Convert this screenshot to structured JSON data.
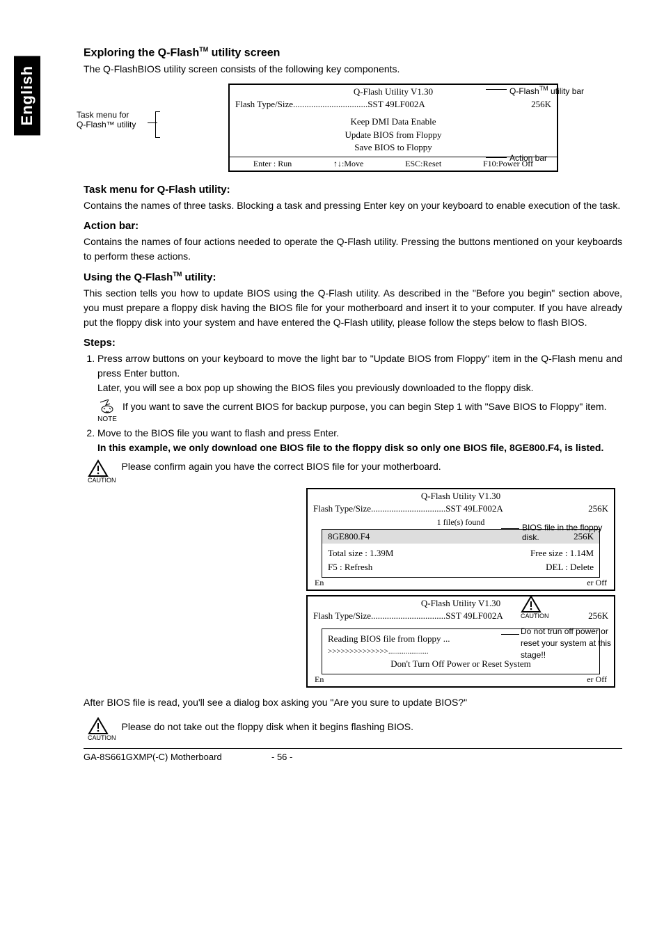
{
  "lang_tab": "English",
  "sec1_title_a": "Exploring the Q-Flash",
  "sec1_title_tm": "TM",
  "sec1_title_b": " utility screen",
  "sec1_intro": "The Q-FlashBIOS utility screen consists of the following key components.",
  "diagram1": {
    "left_label_l1": "Task menu for",
    "left_label_l2": "Q-Flash™ utility",
    "right_label_top_a": "Q-Flash",
    "right_label_top_tm": "TM",
    "right_label_top_b": " utility bar",
    "right_label_bot": "Action bar",
    "title": "Q-Flash Utility V1.30",
    "flash_label": "Flash Type/Size.................................SST 49LF002A",
    "flash_size": "256K",
    "menu_l1": "Keep DMI Data    Enable",
    "menu_l2": "Update BIOS from Floppy",
    "menu_l3": "Save BIOS to Floppy",
    "act1": "Enter : Run",
    "act2": "↑↓:Move",
    "act3": "ESC:Reset",
    "act4": "F10:Power Off"
  },
  "task_menu_heading": "Task menu for Q-Flash utility:",
  "task_menu_body": "Contains the names of three tasks. Blocking a task and pressing Enter key on your keyboard to enable execution of the task.",
  "action_bar_heading": "Action bar:",
  "action_bar_body": "Contains the names of four actions needed to operate the Q-Flash utility. Pressing the buttons mentioned on your keyboards to perform these actions.",
  "using_title_a": "Using the Q-Flash",
  "using_title_tm": "TM",
  "using_title_b": " utility:",
  "using_body": "This section tells you how to update BIOS using the Q-Flash utility. As described in the \"Before you begin\" section above, you must prepare a floppy disk having the BIOS file for your motherboard and insert it to your computer. If you have already put the floppy disk into your system and have entered the Q-Flash utility, please follow the steps below to flash BIOS.",
  "steps_heading": "Steps:",
  "step1_a": "Press arrow buttons on your keyboard to move the light bar to \"Update BIOS from Floppy\" item in the  Q-Flash menu and press Enter button.",
  "step1_b": "Later, you will see a box pop up showing the BIOS files you previously downloaded to the floppy disk.",
  "note1": "If you want to save the current BIOS for backup purpose, you can begin Step 1 with \"Save BIOS to Floppy\" item.",
  "note_label": "NOTE",
  "step2_a": "Move to the BIOS file you want to flash and press Enter.",
  "step2_bold": "In this example, we only download one BIOS file to the floppy disk so only one BIOS file, 8GE800.F4, is listed.",
  "caution1": "Please confirm again you have the correct BIOS file for your motherboard.",
  "caution_label": "CAUTION",
  "diagram2": {
    "title": "Q-Flash Utility V1.30",
    "flash_label": "Flash Type/Size.................................SST 49LF002A",
    "flash_size": "256K",
    "files_found": "1 file(s) found",
    "file_name": "8GE800.F4",
    "file_size": "256K",
    "total": "Total size : 1.39M",
    "free": "Free size : 1.14M",
    "refresh": "F5 : Refresh",
    "delete": "DEL : Delete",
    "left_trunc": "En",
    "right_trunc": "er Off",
    "right_label_l1": "BIOS file in the floppy",
    "right_label_l2": "disk."
  },
  "diagram3": {
    "title": "Q-Flash Utility V1.30",
    "flash_label": "Flash Type/Size.................................SST 49LF002A",
    "flash_size": "256K",
    "reading": "Reading BIOS file from floppy ...",
    "progress": ">>>>>>>>>>>>>>.....................",
    "warn": "Don't Turn Off Power or Reset System",
    "left_trunc": "En",
    "right_trunc": "er Off",
    "right_label_l1": "Do not trun off power or",
    "right_label_l2": "reset your system at this",
    "right_label_l3": "stage!!"
  },
  "after_body": "After BIOS file is read, you'll see a dialog box asking you \"Are you sure to update BIOS?\"",
  "caution2": "Please do not take out the floppy disk when it begins flashing BIOS.",
  "footer_left": "GA-8S661GXMP(-C) Motherboard",
  "footer_page": "- 56 -"
}
